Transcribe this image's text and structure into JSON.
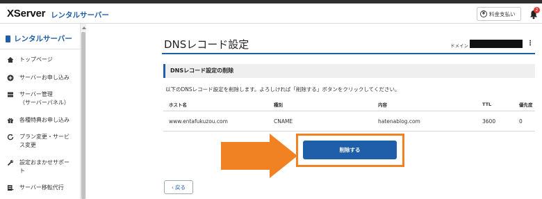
{
  "header": {
    "logo": "XServer",
    "logo_sub": "レンタルサーバー",
    "pay_label": "料金支払い",
    "bell_icon": "bell-icon",
    "notification_count": "2"
  },
  "sidebar": {
    "title": "レンタルサーバー",
    "items": [
      {
        "icon": "home-icon",
        "label": "トップページ"
      },
      {
        "icon": "plus-circle-icon",
        "label": "サーバーお申し込み"
      },
      {
        "icon": "server-icon",
        "label": "サーバー管理",
        "sub": "（サーバーパネル）"
      },
      {
        "icon": "gift-icon",
        "label": "各種特典お申し込み"
      },
      {
        "icon": "refresh-icon",
        "label": "プラン変更・サービス変更"
      },
      {
        "icon": "wrench-icon",
        "label": "設定おまかせサポート"
      },
      {
        "icon": "migration-icon",
        "label": "サーバー移転代行"
      }
    ]
  },
  "main": {
    "page_title": "DNSレコード設定",
    "domain_label": "ドメイン",
    "section_title": "DNSレコード設定の削除",
    "description": "以下のDNSレコード設定を削除します。よろしければ「削除する」ボタンをクリックしてください。",
    "table": {
      "headers": [
        "ホスト名",
        "種別",
        "内容",
        "TTL",
        "優先度"
      ],
      "rows": [
        [
          "www.entafukuzou.com",
          "CNAME",
          "hatenablog.com",
          "3600",
          "0"
        ]
      ]
    },
    "delete_label": "削除する",
    "back_label": "戻る"
  },
  "colors": {
    "accent": "#1f5ea8",
    "annotation_orange": "#f08224",
    "badge_red": "#e53935"
  }
}
